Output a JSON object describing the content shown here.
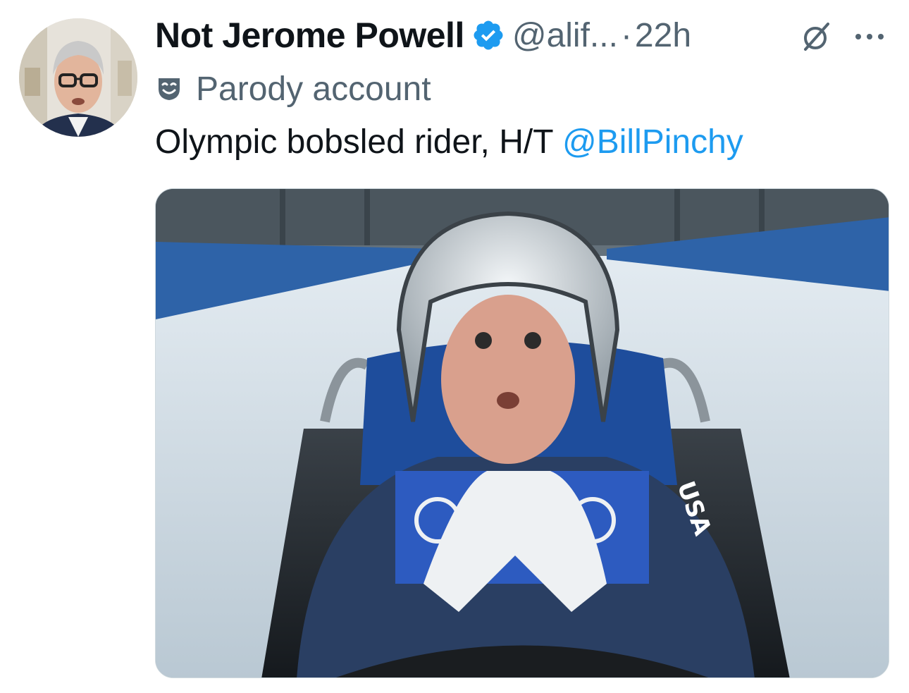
{
  "author": {
    "display_name": "Not Jerome Powell",
    "handle": "@alif...",
    "separator": "·",
    "timestamp": "22h",
    "verified": true,
    "avatar_icon": "avatar-photo"
  },
  "labels": {
    "parody_text": "Parody account",
    "parody_icon": "theater-mask-icon"
  },
  "tweet": {
    "text": "Olympic bobsled rider, H/T ",
    "mention": "@BillPinchy"
  },
  "media": {
    "image_text": "USA"
  },
  "colors": {
    "text_primary": "#0f1419",
    "text_secondary": "#536471",
    "link": "#1d9bf0",
    "verified_badge": "#1d9bf0"
  },
  "icons": {
    "verified": "verified-badge-icon",
    "grok": "grok-icon",
    "more": "more-options-icon"
  }
}
